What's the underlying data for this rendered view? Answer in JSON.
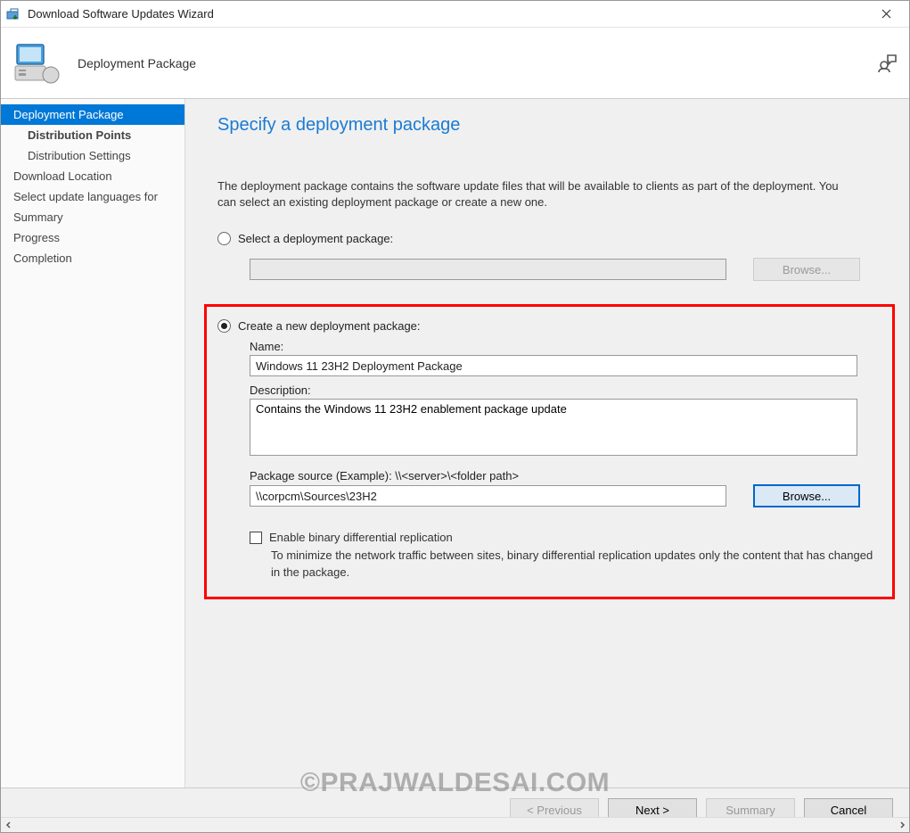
{
  "titlebar": {
    "title": "Download Software Updates Wizard"
  },
  "header": {
    "label": "Deployment Package"
  },
  "sidebar": {
    "items": [
      {
        "label": "Deployment Package"
      },
      {
        "label": "Distribution Points"
      },
      {
        "label": "Distribution Settings"
      },
      {
        "label": "Download Location"
      },
      {
        "label": "Select update languages for"
      },
      {
        "label": "Summary"
      },
      {
        "label": "Progress"
      },
      {
        "label": "Completion"
      }
    ]
  },
  "main": {
    "heading": "Specify a deployment package",
    "description": "The deployment package contains the software update files that will be available to clients as part of the deployment. You can select an existing deployment package or create a new one.",
    "radio_select_label": "Select a deployment package:",
    "browse_disabled_label": "Browse...",
    "radio_create_label": "Create a new deployment package:",
    "name_label": "Name:",
    "name_value": "Windows 11 23H2 Deployment Package",
    "description_label": "Description:",
    "description_value": "Contains the Windows 11 23H2 enablement package update",
    "source_label": "Package source (Example): \\\\<server>\\<folder path>",
    "source_value": "\\\\corpcm\\Sources\\23H2",
    "browse_label": "Browse...",
    "checkbox_label": "Enable binary differential replication",
    "checkbox_desc": "To minimize the network traffic between sites, binary differential replication updates only the content that has changed in the package."
  },
  "footer": {
    "previous": "< Previous",
    "next": "Next >",
    "summary": "Summary",
    "cancel": "Cancel"
  },
  "watermark": "©PRAJWALDESAI.COM"
}
